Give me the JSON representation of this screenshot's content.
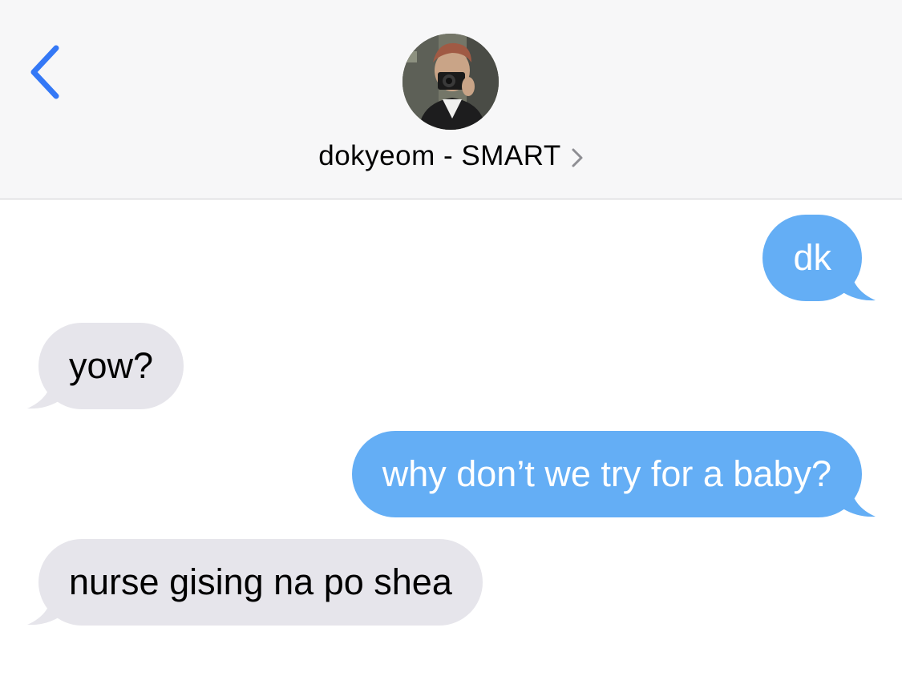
{
  "header": {
    "back_icon": "chevron-left-icon",
    "contact_name": "dokyeom - SMART",
    "avatar_icon": "contact-photo",
    "accent_color": "#3478f6"
  },
  "messages": [
    {
      "direction": "outgoing",
      "text": "dk"
    },
    {
      "direction": "incoming",
      "text": "yow?"
    },
    {
      "direction": "outgoing",
      "text": "why don’t we try for a baby?"
    },
    {
      "direction": "incoming",
      "text": "nurse gising na po shea"
    }
  ],
  "colors": {
    "outgoing_bubble": "#64aef5",
    "incoming_bubble": "#e6e5eb",
    "header_bg": "#f7f7f8"
  }
}
